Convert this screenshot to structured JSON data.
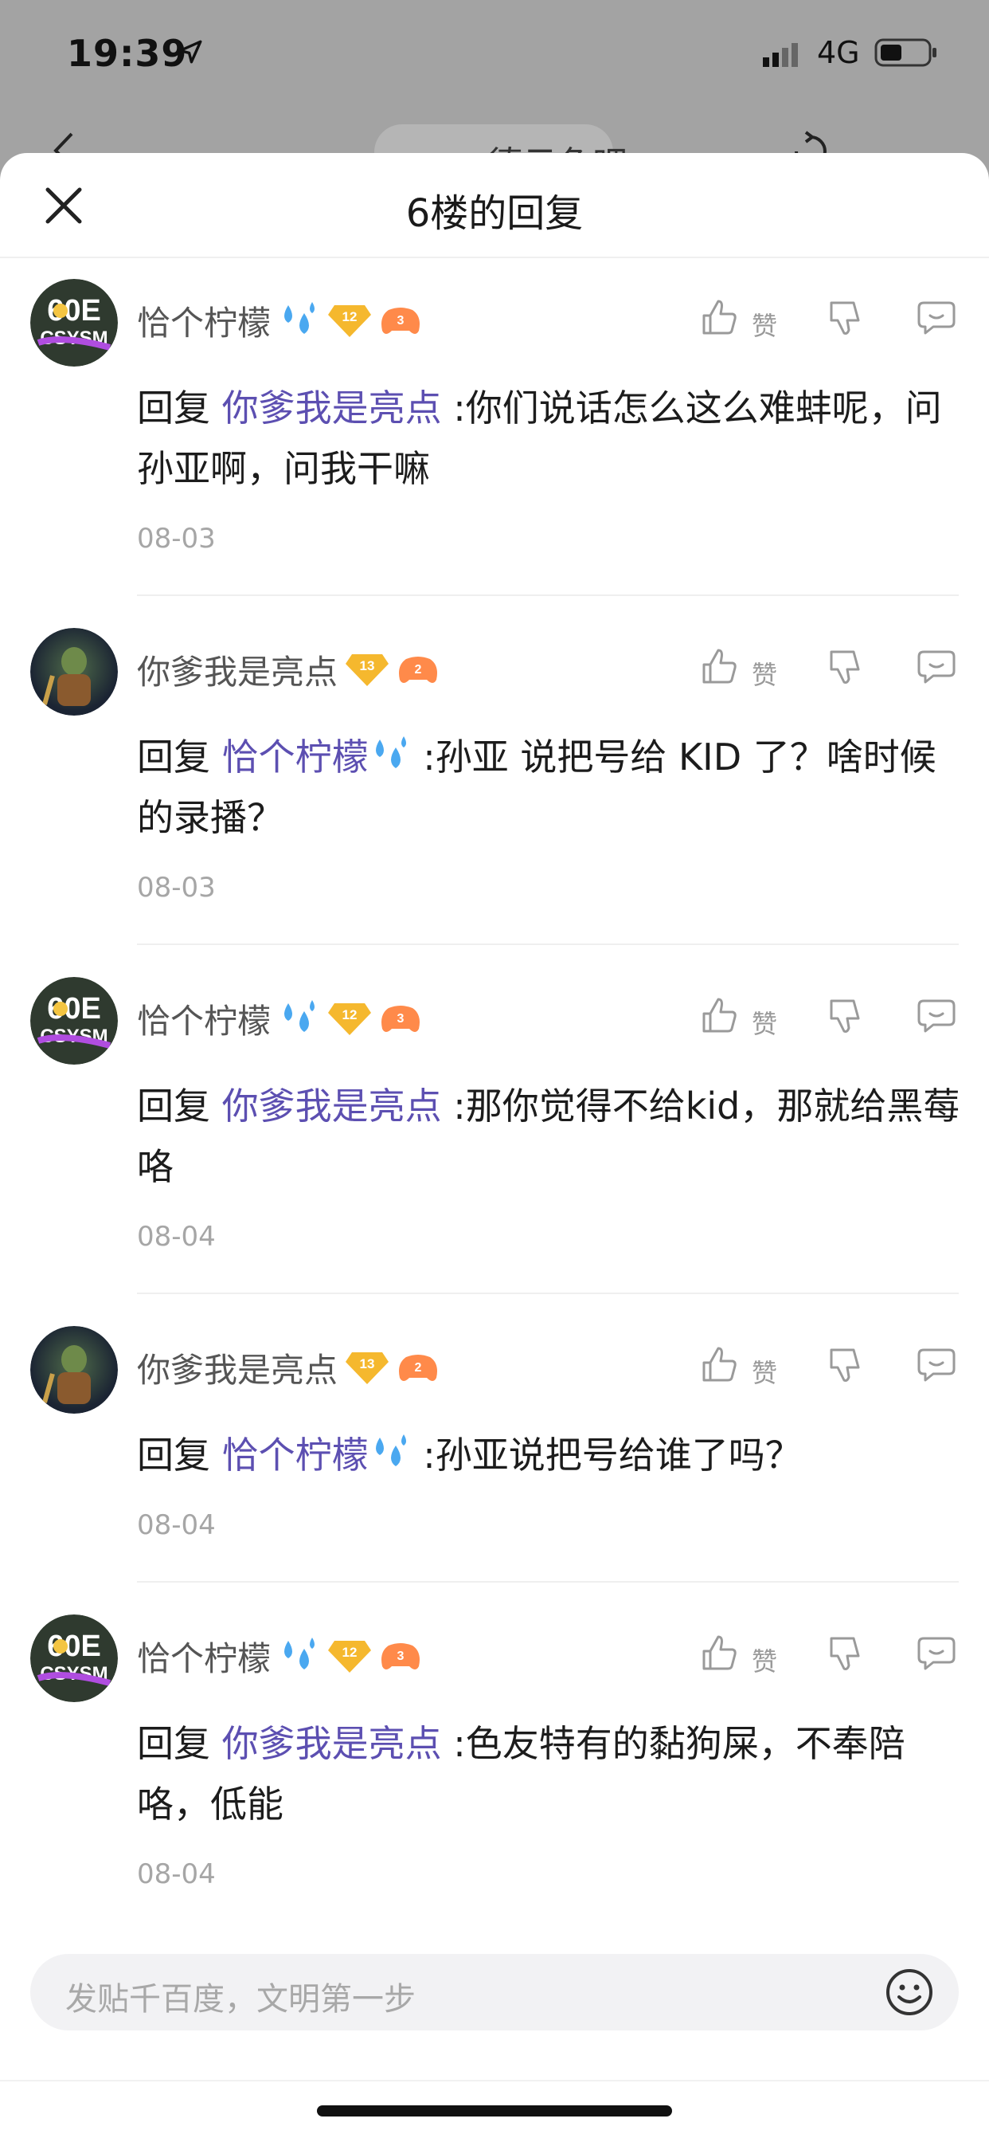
{
  "status": {
    "time": "19:39",
    "network": "4G"
  },
  "background": {
    "title": "德云色吧"
  },
  "sheet": {
    "title": "6楼的回复"
  },
  "actions": {
    "like_label": "赞"
  },
  "replies": [
    {
      "user": "恰个柠檬",
      "level": "12",
      "badge": "3",
      "reply_prefix": "回复",
      "mention": "你爹我是亮点",
      "text": " :你们说话怎么这么难蚌呢，问孙亚啊，问我干嘛",
      "date": "08-03"
    },
    {
      "user": "你爹我是亮点",
      "level": "13",
      "badge": "2",
      "reply_prefix": "回复",
      "mention": "恰个柠檬",
      "text": " :孙亚 说把号给 KID 了？啥时候的录播？",
      "date": "08-03"
    },
    {
      "user": "恰个柠檬",
      "level": "12",
      "badge": "3",
      "reply_prefix": "回复",
      "mention": "你爹我是亮点",
      "text": " :那你觉得不给kid，那就给黑莓咯",
      "date": "08-04"
    },
    {
      "user": "你爹我是亮点",
      "level": "13",
      "badge": "2",
      "reply_prefix": "回复",
      "mention": "恰个柠檬",
      "text": " :孙亚说把号给谁了吗？",
      "date": "08-04"
    },
    {
      "user": "恰个柠檬",
      "level": "12",
      "badge": "3",
      "reply_prefix": "回复",
      "mention": "你爹我是亮点",
      "text": " :色友特有的黏狗屎，不奉陪咯，低能",
      "date": "08-04"
    }
  ],
  "input": {
    "placeholder": "发贴千百度，文明第一步"
  },
  "colors": {
    "mention": "#5c4fb1",
    "level_badge": "#f5b82e",
    "game_badge": "#ff7a3d"
  }
}
